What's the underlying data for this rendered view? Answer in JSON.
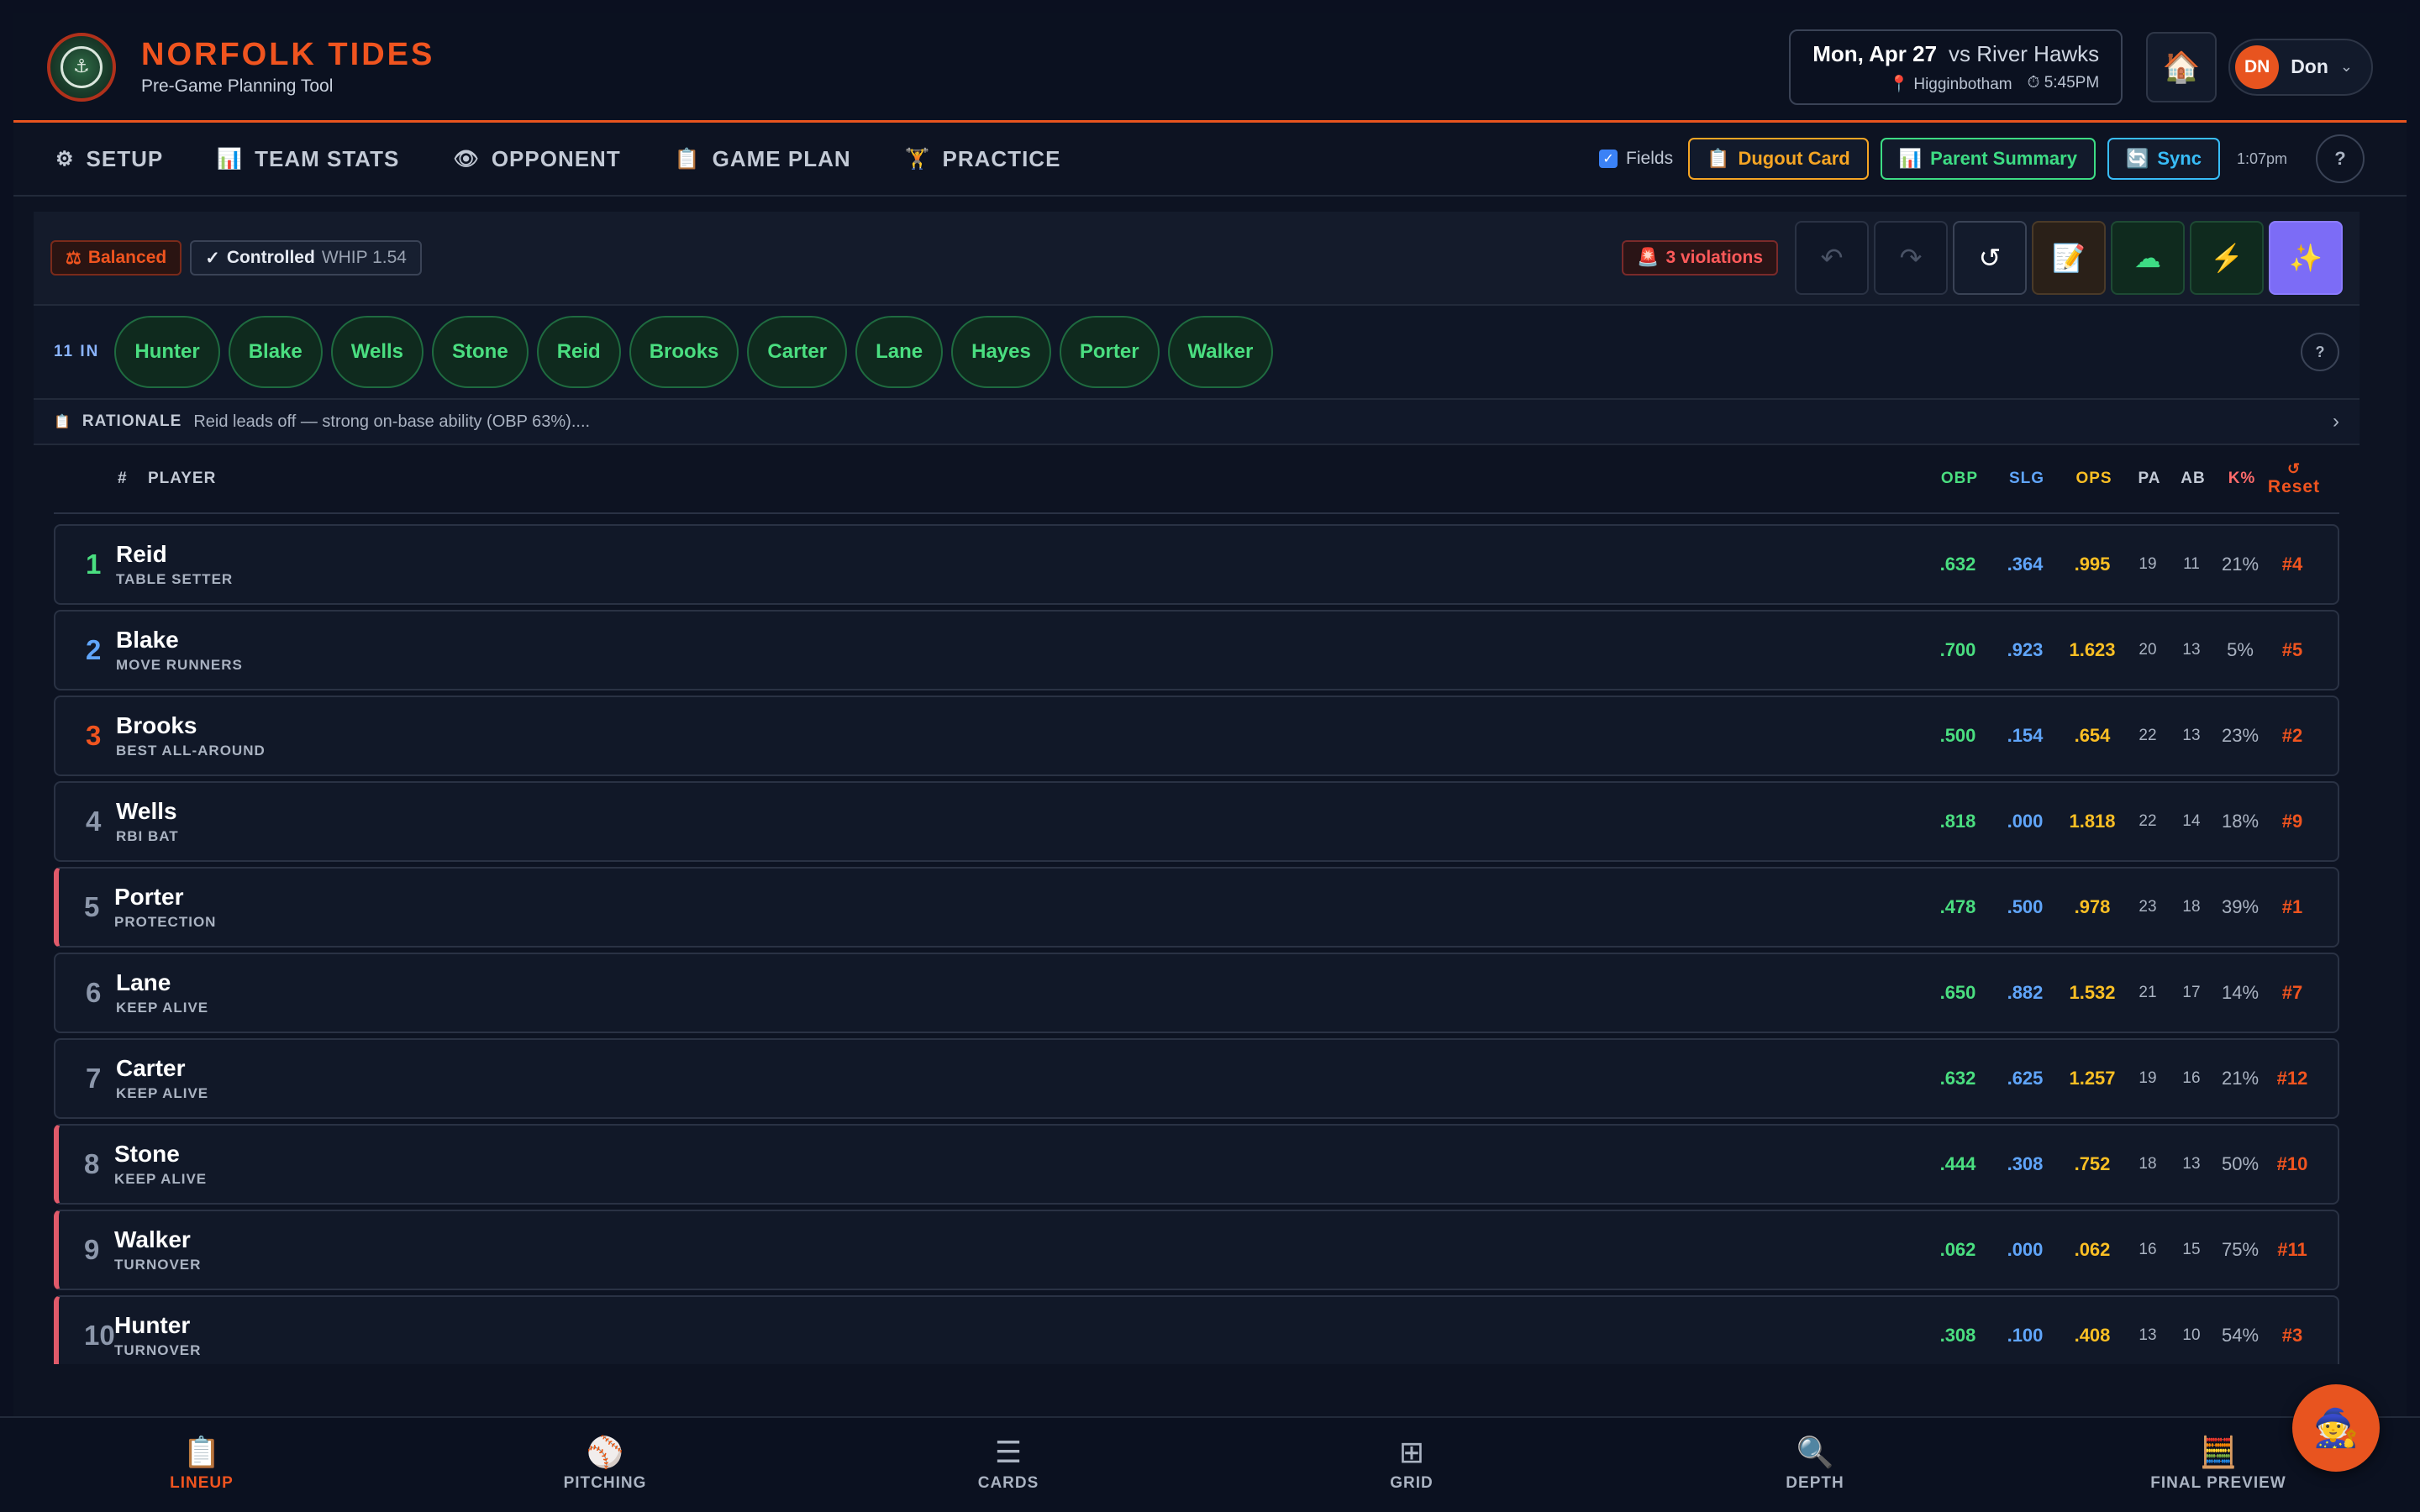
{
  "header": {
    "title": "NORFOLK TIDES",
    "subtitle": "Pre-Game Planning Tool",
    "game": {
      "date": "Mon, Apr 27",
      "opponent": "vs River Hawks",
      "location": "Higginbotham",
      "time": "5:45PM"
    },
    "user": {
      "initials": "DN",
      "name": "Don"
    },
    "icons": {
      "home": "🏠",
      "chevron": "⌄",
      "pin": "📍",
      "clock": "⏱"
    }
  },
  "nav": {
    "tabs": [
      {
        "label": "SETUP",
        "icon": "⚙"
      },
      {
        "label": "TEAM STATS",
        "icon": "📊"
      },
      {
        "label": "OPPONENT",
        "icon": "👁"
      },
      {
        "label": "GAME PLAN",
        "icon": "📋"
      },
      {
        "label": "PRACTICE",
        "icon": "🏋"
      }
    ],
    "fields_label": "Fields",
    "dugout_label": "Dugout Card",
    "dugout_icon": "📋",
    "parent_label": "Parent Summary",
    "parent_icon": "📊",
    "sync_label": "Sync",
    "sync_icon": "🔄",
    "time": "1:07pm",
    "help": "?"
  },
  "toolbar": {
    "balanced_icon": "⚖",
    "balanced": "Balanced",
    "controlled_check": "✓",
    "controlled": "Controlled",
    "whip": "WHIP 1.54",
    "violations_icon": "🚨",
    "violations": "3 violations",
    "undo": "↶",
    "redo": "↷",
    "reset": "↺",
    "doc": "📝",
    "cloud": "☁",
    "bolt": "⚡",
    "magic": "✨"
  },
  "roster": {
    "count_label": "11 IN",
    "players": [
      "Hunter",
      "Blake",
      "Wells",
      "Stone",
      "Reid",
      "Brooks",
      "Carter",
      "Lane",
      "Hayes",
      "Porter",
      "Walker"
    ],
    "help": "?"
  },
  "rationale": {
    "icon": "📋",
    "label": "RATIONALE",
    "text": "Reid leads off — strong on-base ability (OBP 63%)....",
    "arrow": "›"
  },
  "table": {
    "headers": {
      "num": "#",
      "player": "PLAYER",
      "obp": "OBP",
      "slg": "SLG",
      "ops": "OPS",
      "pa": "PA",
      "ab": "AB",
      "k": "K%",
      "reset_icon": "↺",
      "reset": "Reset"
    },
    "rows": [
      {
        "num": "1",
        "name": "Reid",
        "role": "TABLE SETTER",
        "obp": ".632",
        "slg": ".364",
        "ops": ".995",
        "pa": "19",
        "ab": "11",
        "k": "21%",
        "rank": "#4"
      },
      {
        "num": "2",
        "name": "Blake",
        "role": "MOVE RUNNERS",
        "obp": ".700",
        "slg": ".923",
        "ops": "1.623",
        "pa": "20",
        "ab": "13",
        "k": "5%",
        "rank": "#5"
      },
      {
        "num": "3",
        "name": "Brooks",
        "role": "BEST ALL-AROUND",
        "obp": ".500",
        "slg": ".154",
        "ops": ".654",
        "pa": "22",
        "ab": "13",
        "k": "23%",
        "rank": "#2"
      },
      {
        "num": "4",
        "name": "Wells",
        "role": "RBI BAT",
        "obp": ".818",
        "slg": ".000",
        "ops": "1.818",
        "pa": "22",
        "ab": "14",
        "k": "18%",
        "rank": "#9"
      },
      {
        "num": "5",
        "name": "Porter",
        "role": "PROTECTION",
        "obp": ".478",
        "slg": ".500",
        "ops": ".978",
        "pa": "23",
        "ab": "18",
        "k": "39%",
        "rank": "#1"
      },
      {
        "num": "6",
        "name": "Lane",
        "role": "KEEP ALIVE",
        "obp": ".650",
        "slg": ".882",
        "ops": "1.532",
        "pa": "21",
        "ab": "17",
        "k": "14%",
        "rank": "#7"
      },
      {
        "num": "7",
        "name": "Carter",
        "role": "KEEP ALIVE",
        "obp": ".632",
        "slg": ".625",
        "ops": "1.257",
        "pa": "19",
        "ab": "16",
        "k": "21%",
        "rank": "#12"
      },
      {
        "num": "8",
        "name": "Stone",
        "role": "KEEP ALIVE",
        "obp": ".444",
        "slg": ".308",
        "ops": ".752",
        "pa": "18",
        "ab": "13",
        "k": "50%",
        "rank": "#10"
      },
      {
        "num": "9",
        "name": "Walker",
        "role": "TURNOVER",
        "obp": ".062",
        "slg": ".000",
        "ops": ".062",
        "pa": "16",
        "ab": "15",
        "k": "75%",
        "rank": "#11"
      },
      {
        "num": "10",
        "name": "Hunter",
        "role": "TURNOVER",
        "obp": ".308",
        "slg": ".100",
        "ops": ".408",
        "pa": "13",
        "ab": "10",
        "k": "54%",
        "rank": "#3"
      }
    ]
  },
  "bottom_nav": [
    {
      "label": "LINEUP",
      "icon": "📋"
    },
    {
      "label": "PITCHING",
      "icon": "⚾"
    },
    {
      "label": "CARDS",
      "icon": "☰"
    },
    {
      "label": "GRID",
      "icon": "⊞"
    },
    {
      "label": "DEPTH",
      "icon": "🔍"
    },
    {
      "label": "FINAL PREVIEW",
      "icon": "🧮"
    }
  ],
  "fab_icon": "🧙"
}
